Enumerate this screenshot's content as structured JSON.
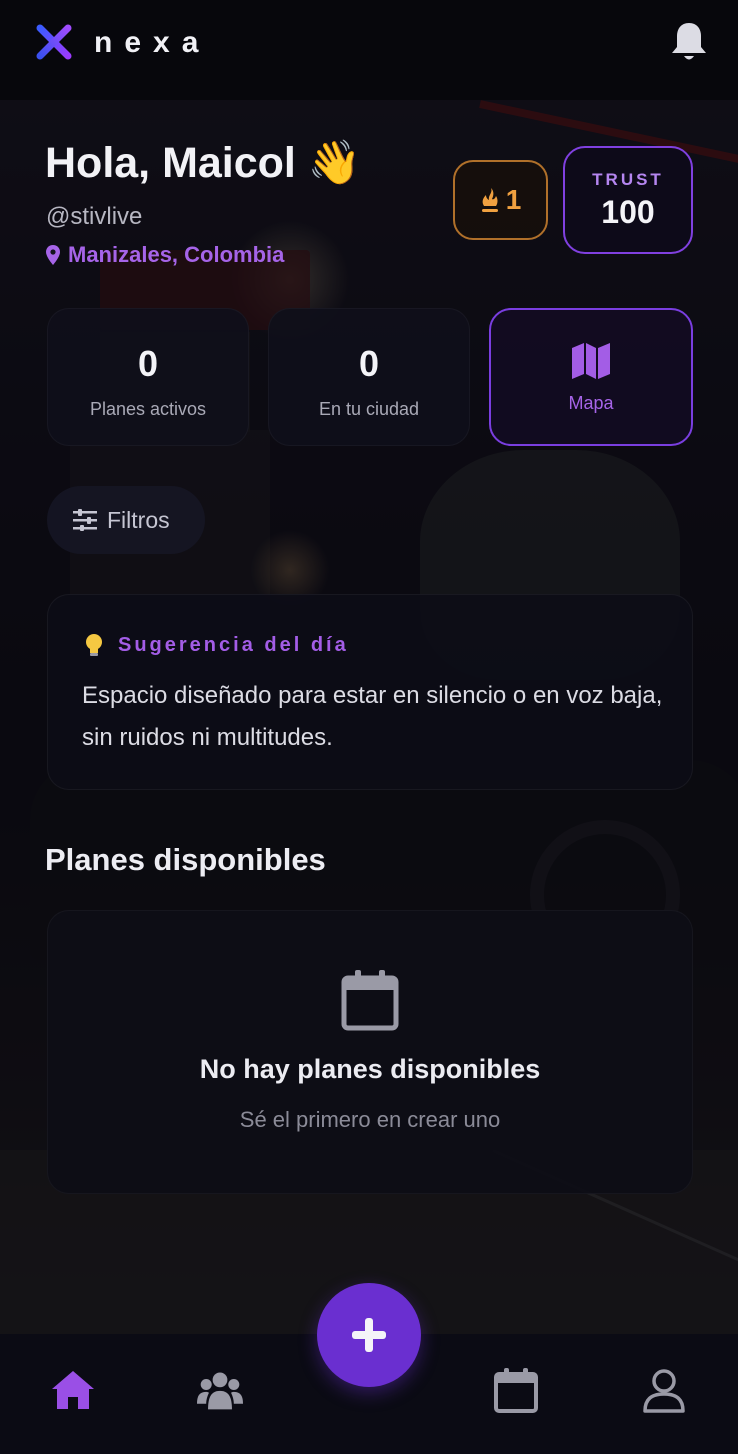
{
  "app": {
    "brand": "nexa"
  },
  "header": {
    "greeting": "Hola, Maicol 👋",
    "handle": "@stivlive",
    "location": "Manizales, Colombia"
  },
  "streak": {
    "value": "1"
  },
  "trust": {
    "label": "TRUST",
    "value": "100"
  },
  "stats": [
    {
      "value": "0",
      "label": "Planes activos"
    },
    {
      "value": "0",
      "label": "En tu ciudad"
    }
  ],
  "map_button": {
    "label": "Mapa",
    "icon": "map-icon"
  },
  "filters": {
    "label": "Filtros",
    "icon": "sliders-icon"
  },
  "suggestion": {
    "title": "Sugerencia del día",
    "text": "Espacio diseñado para estar en silencio o en voz baja, sin ruidos ni multitudes.",
    "icon": "lightbulb-icon"
  },
  "plans": {
    "section_title": "Planes disponibles",
    "empty_title": "No hay planes disponibles",
    "empty_subtitle": "Sé el primero en crear uno",
    "empty_icon": "calendar-icon"
  },
  "bottom_nav": [
    {
      "icon": "home-icon",
      "active": true
    },
    {
      "icon": "users-icon",
      "active": false
    },
    {
      "icon": "plus-icon",
      "active": false
    },
    {
      "icon": "calendar-icon",
      "active": false
    },
    {
      "icon": "profile-icon",
      "active": false
    }
  ],
  "colors": {
    "accent": "#7a3ee0",
    "accent_text": "#a664e8",
    "streak": "#f0a040",
    "background": "#07070c",
    "card": "#0f0f1a"
  }
}
